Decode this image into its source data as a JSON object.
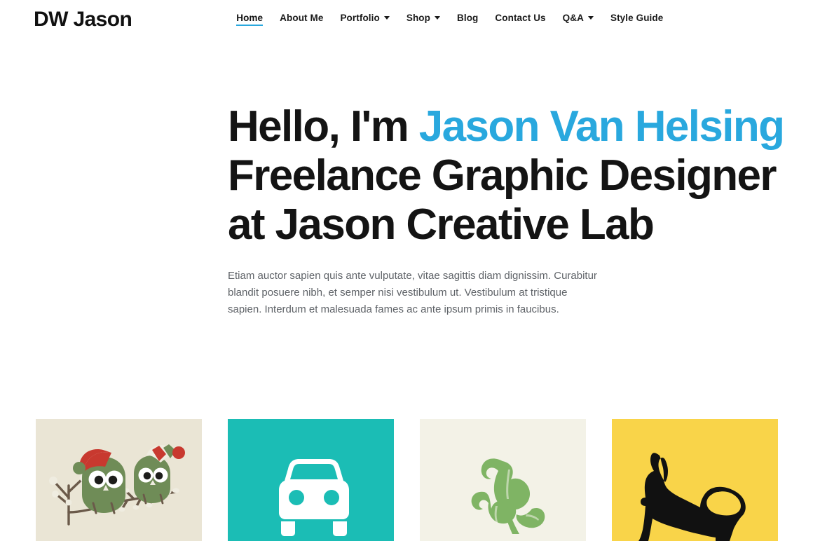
{
  "header": {
    "logo": "DW Jason",
    "nav": [
      {
        "label": "Home",
        "active": true,
        "caret": false,
        "name": "nav-item-home"
      },
      {
        "label": "About Me",
        "active": false,
        "caret": false,
        "name": "nav-item-about-me"
      },
      {
        "label": "Portfolio",
        "active": false,
        "caret": true,
        "name": "nav-item-portfolio"
      },
      {
        "label": "Shop",
        "active": false,
        "caret": true,
        "name": "nav-item-shop"
      },
      {
        "label": "Blog",
        "active": false,
        "caret": false,
        "name": "nav-item-blog"
      },
      {
        "label": "Contact Us",
        "active": false,
        "caret": false,
        "name": "nav-item-contact-us"
      },
      {
        "label": "Q&A",
        "active": false,
        "caret": true,
        "name": "nav-item-qa"
      },
      {
        "label": "Style Guide",
        "active": false,
        "caret": false,
        "name": "nav-item-style-guide"
      }
    ]
  },
  "hero": {
    "greeting": "Hello, I'm ",
    "name": "Jason Van Helsing",
    "line2": "Freelance Graphic Designer",
    "line3": "at Jason Creative Lab",
    "paragraph": "Etiam auctor sapien quis ante vulputate, vitae sagittis diam dignissim. Curabitur blandit posuere nibh, et semper nisi vestibulum ut. Vestibulum at tristique sapien. Interdum et malesuada fames ac ante ipsum primis in faucibus."
  },
  "portfolio_thumbs": [
    {
      "name": "thumb-owls-on-branch",
      "art": "owls",
      "bg": "#eae5d5"
    },
    {
      "name": "thumb-car-icon",
      "art": "car",
      "bg": "#1bbdb5"
    },
    {
      "name": "thumb-green-plant",
      "art": "leaf",
      "bg": "#f3f2e7"
    },
    {
      "name": "thumb-silhouette-yellow",
      "art": "silhouette",
      "bg": "#f9d449"
    }
  ],
  "colors": {
    "accent_blue": "#29a8de",
    "text_dark": "#141414",
    "text_muted": "#5f6368",
    "page_bg": "#ffffff"
  }
}
